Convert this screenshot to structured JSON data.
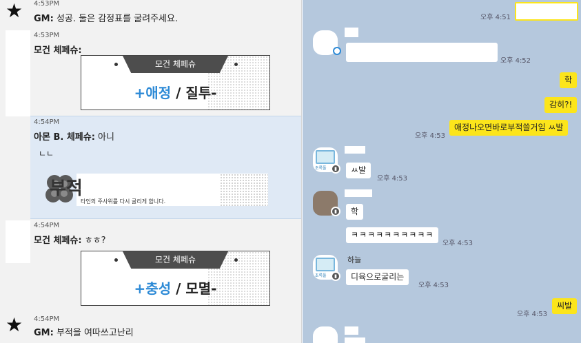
{
  "game_log": {
    "entries": [
      {
        "time": "4:53PM",
        "speaker": "GM:",
        "message": "성공. 둘은 감정표를 굴려주세요."
      },
      {
        "time": "4:53PM",
        "speaker": "모건 체페슈:",
        "message": ""
      },
      {
        "time": "4:54PM",
        "speaker": "아몬 B. 체페슈:",
        "message": "아니",
        "extra": "ㄴㄴ"
      },
      {
        "time": "4:54PM",
        "speaker": "모건 체페슈:",
        "message": "ㅎㅎ?"
      },
      {
        "time": "4:54PM",
        "speaker": "GM:",
        "message": "부적을 여따쓰고난리"
      }
    ],
    "emotion_card_1": {
      "banner": "모건 체페슈",
      "positive": "+애정",
      "slash": "/",
      "negative": "질투-"
    },
    "emotion_card_2": {
      "banner": "모건 체페슈",
      "positive": "+충성",
      "slash": "/",
      "negative": "모멸-"
    },
    "talisman_card": {
      "title": "부적",
      "description": "타인의 주사위를 다시 굴리게 합니다."
    }
  },
  "chat": {
    "messages": [
      {
        "from": "me",
        "text": "",
        "time": "오후 4:51"
      },
      {
        "from": "other",
        "text": "",
        "time": "오후 4:52"
      },
      {
        "from": "me",
        "text": "학",
        "time": ""
      },
      {
        "from": "me",
        "text": "감히?!",
        "time": ""
      },
      {
        "from": "me",
        "text": "애정나오면바로부적쓸거임 ㅆ발",
        "time": "오후 4:53"
      },
      {
        "from": "other",
        "text": "ㅆ발",
        "time": "오후 4:53"
      },
      {
        "from": "other",
        "text": "학",
        "time": ""
      },
      {
        "from": "other",
        "text": "ㅋㅋㅋㅋㅋㅋㅋㅋㅋㅋ",
        "time": "오후 4:53"
      },
      {
        "from": "other",
        "name": "하늘",
        "text": "디육으로굴리는",
        "time": "오후 4:53"
      },
      {
        "from": "me",
        "text": "씨발",
        "time": "오후 4:53"
      }
    ],
    "profile_label": "초록풀"
  },
  "colors": {
    "my_bubble": "#fce51b",
    "chat_bg": "#b5c8dd",
    "highlight": "#dfe9f5",
    "positive_emotion": "#2d8ad6"
  }
}
